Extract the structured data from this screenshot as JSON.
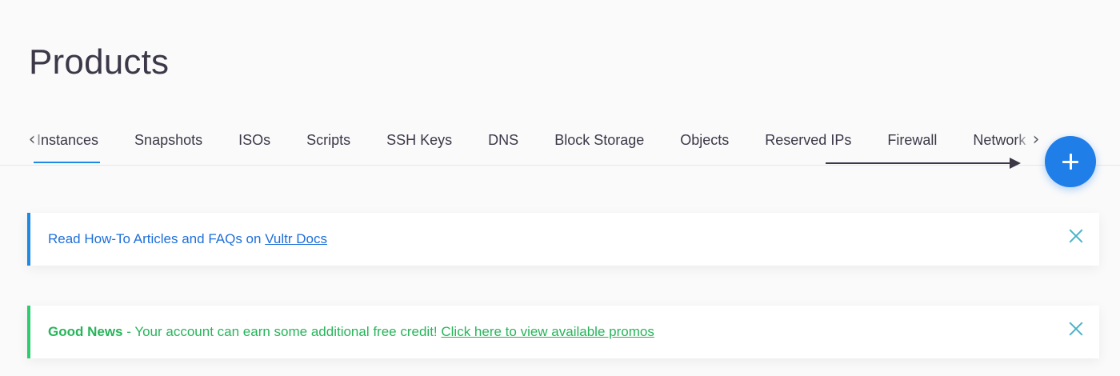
{
  "page": {
    "title": "Products"
  },
  "tabs": {
    "items": [
      {
        "label": "Instances",
        "active": true
      },
      {
        "label": "Snapshots",
        "active": false
      },
      {
        "label": "ISOs",
        "active": false
      },
      {
        "label": "Scripts",
        "active": false
      },
      {
        "label": "SSH Keys",
        "active": false
      },
      {
        "label": "DNS",
        "active": false
      },
      {
        "label": "Block Storage",
        "active": false
      },
      {
        "label": "Objects",
        "active": false
      },
      {
        "label": "Reserved IPs",
        "active": false
      },
      {
        "label": "Firewall",
        "active": false
      },
      {
        "label": "Network",
        "active": false
      }
    ],
    "scroll_left_icon": "chevron-left-icon",
    "scroll_right_icon": "chevron-right-icon"
  },
  "fab": {
    "icon": "plus-icon",
    "color": "#1f7ee8"
  },
  "notices": {
    "docs": {
      "text": "Read How-To Articles and FAQs on ",
      "link": "Vultr Docs",
      "color": "#1e6fd9",
      "close_icon": "close-icon"
    },
    "promo": {
      "strong": "Good News",
      "text": " - Your account can earn some additional free credit!  ",
      "link": "Click here to view available promos",
      "color": "#27b45a",
      "close_icon": "close-icon"
    }
  },
  "colors": {
    "accent": "#1e88e5",
    "success": "#2ecc71",
    "text": "#3c3848"
  }
}
